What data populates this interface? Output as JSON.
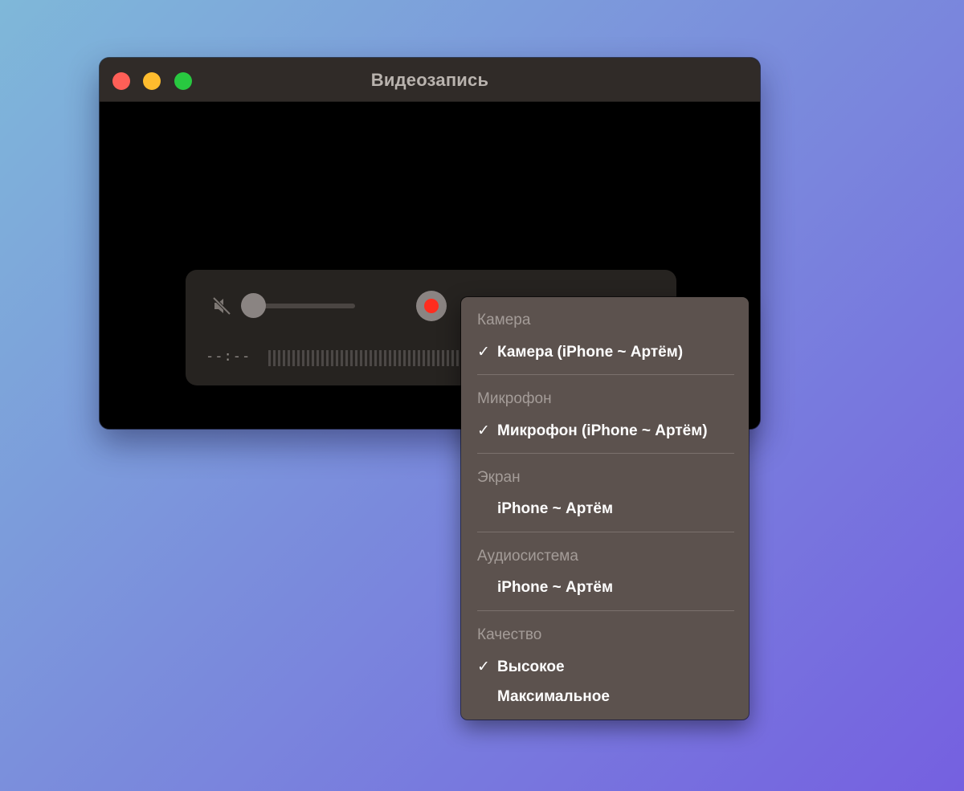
{
  "window": {
    "title": "Видеозапись"
  },
  "controls": {
    "timecode": "--:--",
    "volume_level": 0.0,
    "muted": true
  },
  "menu": {
    "sections": [
      {
        "header": "Камера",
        "items": [
          {
            "label": "Камера (iPhone ~ Артём)",
            "checked": true
          }
        ]
      },
      {
        "header": "Микрофон",
        "items": [
          {
            "label": "Микрофон (iPhone ~ Артём)",
            "checked": true
          }
        ]
      },
      {
        "header": "Экран",
        "items": [
          {
            "label": "iPhone ~ Артём",
            "checked": false
          }
        ]
      },
      {
        "header": "Аудиосистема",
        "items": [
          {
            "label": "iPhone ~ Артём",
            "checked": false
          }
        ]
      },
      {
        "header": "Качество",
        "items": [
          {
            "label": "Высокое",
            "checked": true
          },
          {
            "label": "Максимальное",
            "checked": false
          }
        ]
      }
    ],
    "check_glyph": "✓"
  },
  "colors": {
    "close": "#fe5f57",
    "minimize": "#febc2e",
    "maximize": "#28c840",
    "record": "#ff2d1f"
  },
  "icons": {
    "mute": "speaker-muted-icon",
    "record": "record-icon",
    "check": "checkmark-icon"
  }
}
